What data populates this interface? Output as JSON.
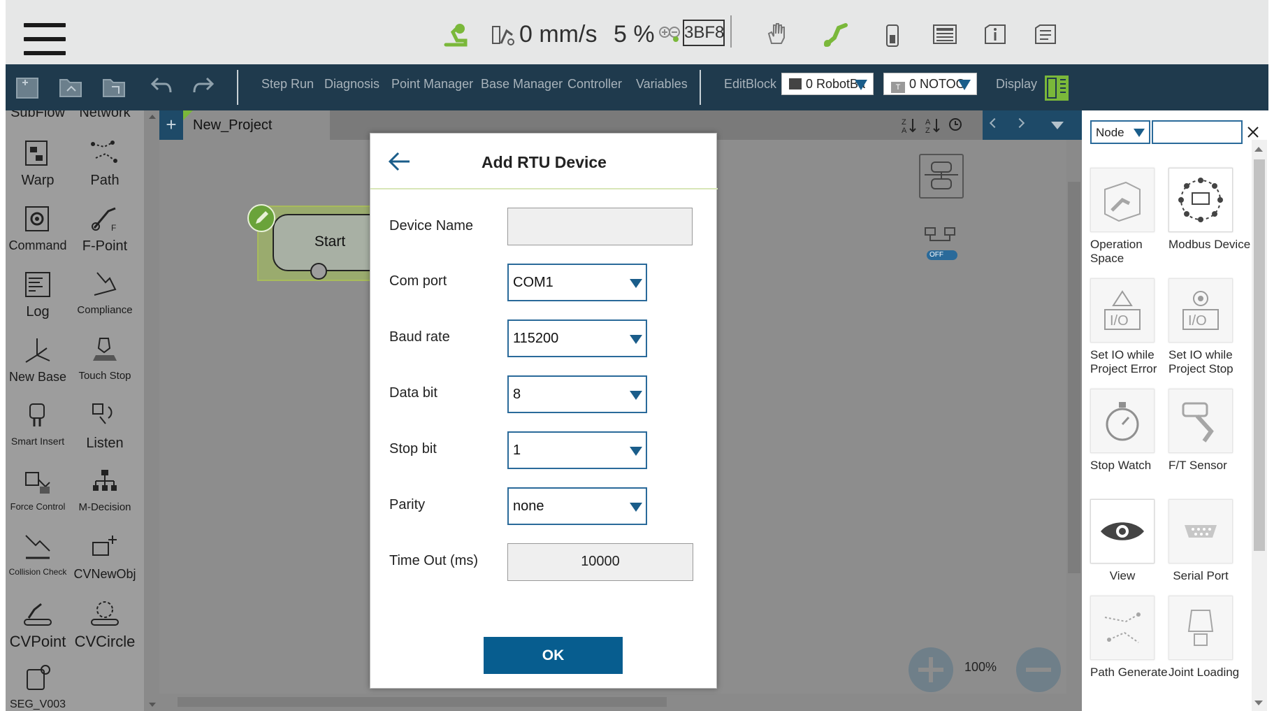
{
  "topbar": {
    "speed": "0 mm/s",
    "percent": "5 %",
    "code": "3BF8"
  },
  "toolbar": {
    "items": [
      "Step Run",
      "Diagnosis",
      "Point Manager",
      "Base Manager",
      "Controller",
      "Variables",
      "EditBlock"
    ],
    "base_combo": "0 RobotBa",
    "tool_combo": "0 NOTOO",
    "display": "Display"
  },
  "left_panel": {
    "partial_top": [
      "SubFlow",
      "Network"
    ],
    "items": [
      [
        "Warp",
        "Path"
      ],
      [
        "Command",
        "F-Point"
      ],
      [
        "Log",
        "Compliance"
      ],
      [
        "New Base",
        "Touch Stop"
      ],
      [
        "Smart Insert",
        "Listen"
      ],
      [
        "Force Control",
        "M-Decision"
      ],
      [
        "Collision Check",
        "CVNewObj"
      ],
      [
        "CVPoint",
        "CVCircle"
      ],
      [
        "SEG_V003",
        ""
      ]
    ]
  },
  "canvas": {
    "tab": "New_Project",
    "start_node": "Start",
    "toggle_label": "OFF",
    "zoom": "100%"
  },
  "right_panel": {
    "filter": "Node",
    "search_value": "",
    "items": [
      [
        "Operation Space",
        "Modbus Device"
      ],
      [
        "Set IO while Project Error",
        "Set IO while Project Stop"
      ],
      [
        "Stop Watch",
        "F/T Sensor"
      ],
      [
        "View",
        "Serial Port"
      ],
      [
        "Path Generate",
        "Joint Loading"
      ]
    ]
  },
  "dialog": {
    "title": "Add RTU Device",
    "fields": {
      "device_name": {
        "label": "Device Name",
        "value": ""
      },
      "com_port": {
        "label": "Com port",
        "value": "COM1"
      },
      "baud_rate": {
        "label": "Baud rate",
        "value": "115200"
      },
      "data_bit": {
        "label": "Data bit",
        "value": "8"
      },
      "stop_bit": {
        "label": "Stop bit",
        "value": "1"
      },
      "parity": {
        "label": "Parity",
        "value": "none"
      },
      "timeout": {
        "label": "Time Out (ms)",
        "value": "10000"
      }
    },
    "ok_label": "OK"
  },
  "colors": {
    "toolbar_bg": "#1f3a4d",
    "accent_blue": "#075d8f",
    "panel_gray": "#9d9d9d",
    "robot_green": "#7ab83a"
  }
}
